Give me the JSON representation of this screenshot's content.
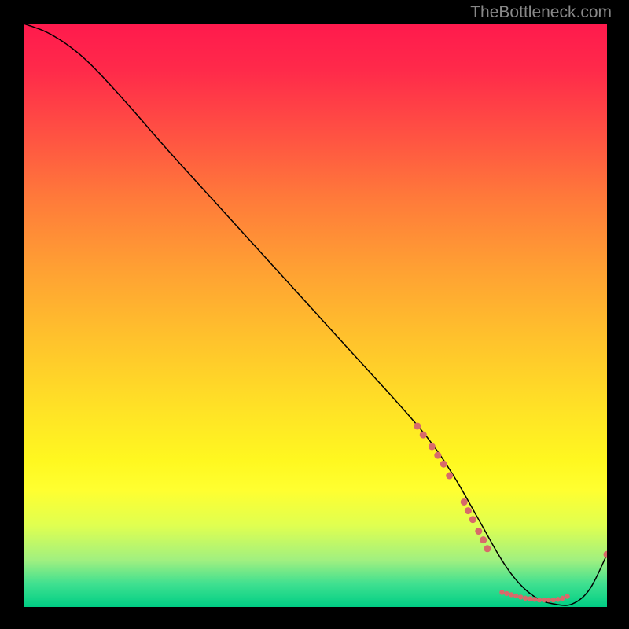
{
  "watermark": "TheBottleneck.com",
  "chart_data": {
    "type": "line",
    "title": "",
    "xlabel": "",
    "ylabel": "",
    "xlim": [
      0,
      100
    ],
    "ylim": [
      0,
      100
    ],
    "curve": {
      "x": [
        0,
        4,
        8,
        12,
        18,
        25,
        35,
        45,
        55,
        65,
        70,
        74,
        78,
        82,
        85,
        88,
        91,
        94,
        97,
        100
      ],
      "y": [
        100,
        98.5,
        96,
        92.5,
        86,
        78,
        67,
        56,
        45,
        34,
        28,
        22,
        15,
        8,
        4,
        1.5,
        0.5,
        0.5,
        3,
        9
      ]
    },
    "scatter_points": [
      {
        "x": 67.5,
        "y": 31,
        "r": 4.5
      },
      {
        "x": 68.5,
        "y": 29.5,
        "r": 4.5
      },
      {
        "x": 70,
        "y": 27.5,
        "r": 4.5
      },
      {
        "x": 71,
        "y": 26,
        "r": 4.5
      },
      {
        "x": 72,
        "y": 24.5,
        "r": 4.5
      },
      {
        "x": 73,
        "y": 22.5,
        "r": 4.5
      },
      {
        "x": 75.5,
        "y": 18,
        "r": 4.5
      },
      {
        "x": 76.2,
        "y": 16.5,
        "r": 4.5
      },
      {
        "x": 77,
        "y": 15,
        "r": 4.5
      },
      {
        "x": 78,
        "y": 13,
        "r": 4.5
      },
      {
        "x": 78.8,
        "y": 11.5,
        "r": 4.5
      },
      {
        "x": 79.5,
        "y": 10,
        "r": 4.5
      },
      {
        "x": 82,
        "y": 2.5,
        "r": 3.2
      },
      {
        "x": 82.8,
        "y": 2.3,
        "r": 3.2
      },
      {
        "x": 83.6,
        "y": 2.1,
        "r": 3.2
      },
      {
        "x": 84.4,
        "y": 1.9,
        "r": 3.2
      },
      {
        "x": 85.2,
        "y": 1.7,
        "r": 3.2
      },
      {
        "x": 86,
        "y": 1.5,
        "r": 3.2
      },
      {
        "x": 86.8,
        "y": 1.4,
        "r": 3.2
      },
      {
        "x": 87.6,
        "y": 1.3,
        "r": 3.2
      },
      {
        "x": 88.4,
        "y": 1.2,
        "r": 3.2
      },
      {
        "x": 89.2,
        "y": 1.2,
        "r": 3.2
      },
      {
        "x": 90,
        "y": 1.2,
        "r": 3.2
      },
      {
        "x": 90.8,
        "y": 1.2,
        "r": 3.2
      },
      {
        "x": 91.6,
        "y": 1.3,
        "r": 3.2
      },
      {
        "x": 92.4,
        "y": 1.5,
        "r": 3.2
      },
      {
        "x": 93.2,
        "y": 1.8,
        "r": 3.2
      },
      {
        "x": 100,
        "y": 9,
        "r": 4.5
      }
    ],
    "gradient_stops": [
      {
        "pos": 0,
        "color": "#ff1a4d"
      },
      {
        "pos": 100,
        "color": "#00cc84"
      }
    ]
  }
}
